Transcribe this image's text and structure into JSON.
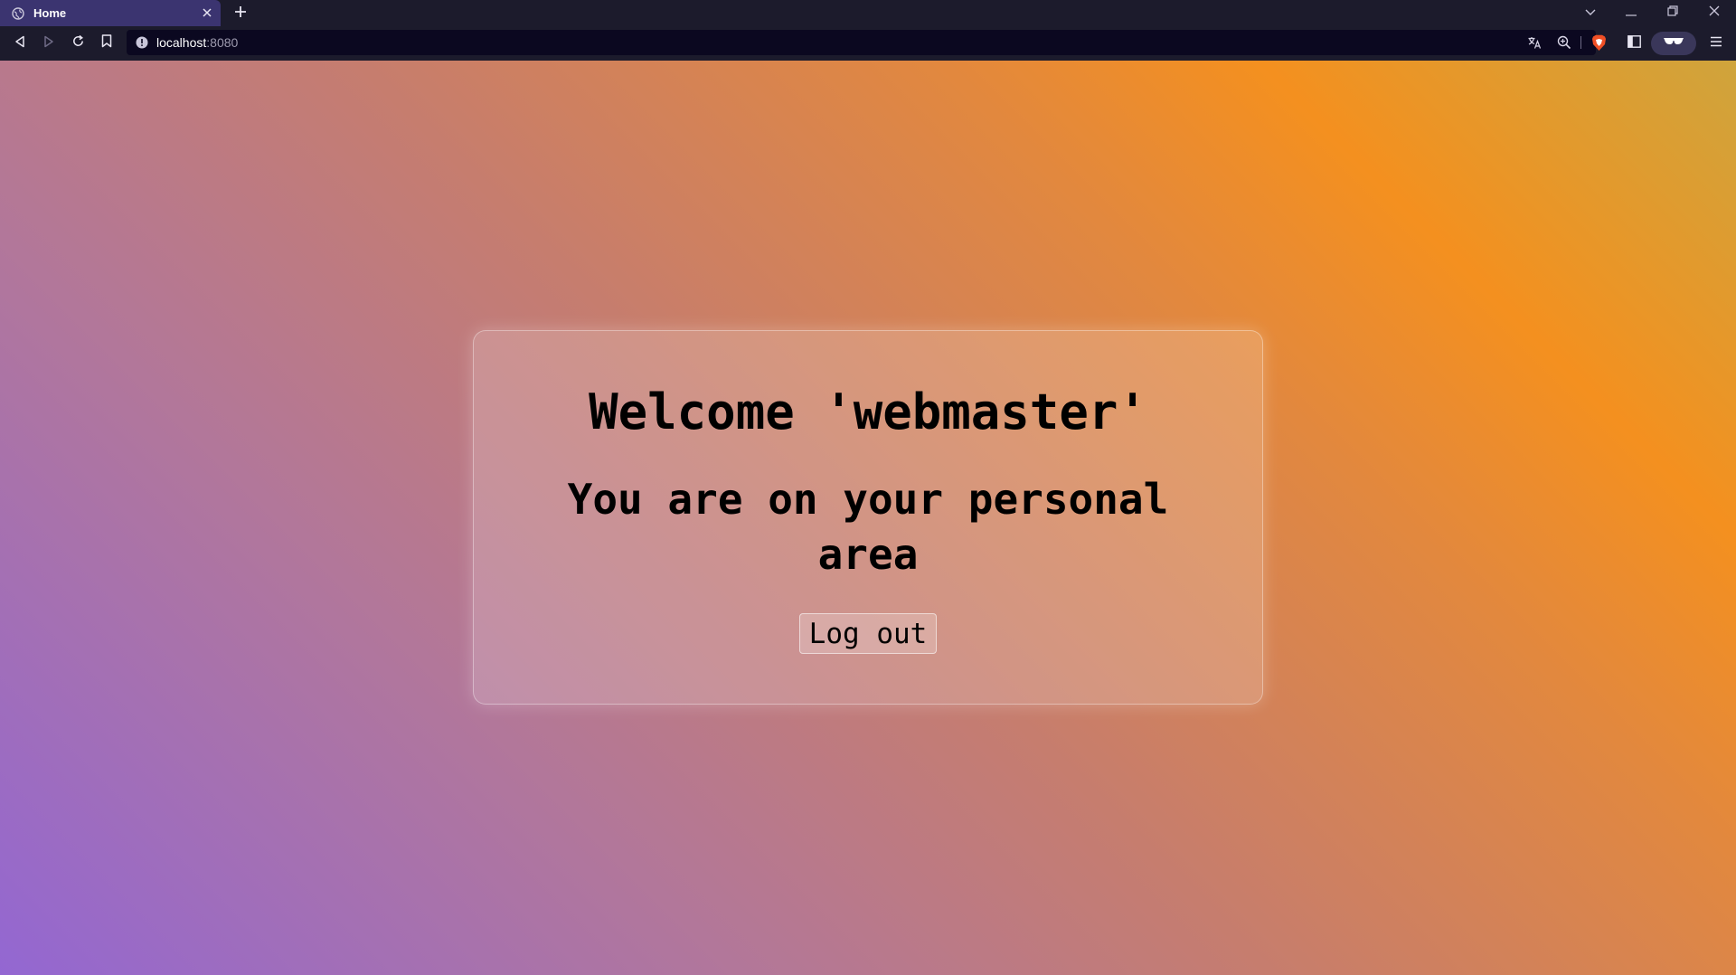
{
  "browser": {
    "tab": {
      "title": "Home",
      "favicon": "globe-icon"
    },
    "address": {
      "host": "localhost",
      "port": ":8080"
    },
    "colors": {
      "chrome_bg": "#1c1b2c",
      "active_tab_bg": "#3b3470",
      "urlbar_bg": "#0b0820",
      "brave_shield": "#f04f25"
    },
    "icons": {
      "tab_close": "close-icon",
      "new_tab": "plus-icon",
      "tab_search": "chevron-down-icon",
      "minimize": "minimize-icon",
      "restore": "restore-icon",
      "close_window": "close-icon",
      "back": "back-icon",
      "forward": "forward-icon",
      "reload": "reload-icon",
      "bookmark": "bookmark-icon",
      "site_info": "info-icon",
      "translate": "translate-icon",
      "zoom": "zoom-icon",
      "shields": "brave-shield-icon",
      "sidebar": "sidebar-icon",
      "extension": "glasses-icon",
      "menu": "hamburger-menu-icon"
    }
  },
  "page": {
    "welcome": "Welcome 'webmaster'",
    "subtitle": "You are on your personal area",
    "logout_label": "Log out",
    "colors": {
      "gradient": [
        "#9367d2",
        "#b2779a",
        "#c67d6e",
        "#e2883e",
        "#f4901f",
        "#cfa43c"
      ],
      "text": "#000000"
    }
  }
}
